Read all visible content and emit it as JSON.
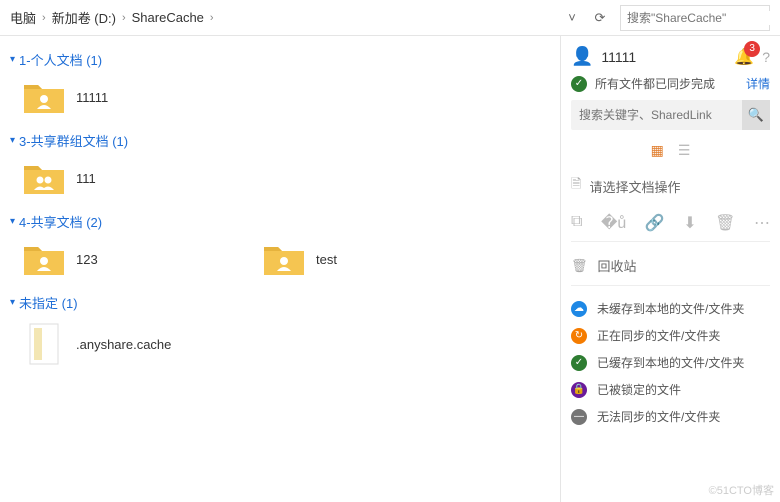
{
  "breadcrumbs": [
    "电脑",
    "新加卷 (D:)",
    "ShareCache"
  ],
  "search": {
    "placeholder": "搜索\"ShareCache\""
  },
  "groups": [
    {
      "label": "1-个人文档 (1)",
      "items": [
        {
          "name": "11111",
          "icon": "person"
        }
      ]
    },
    {
      "label": "3-共享群组文档 (1)",
      "items": [
        {
          "name": "111",
          "icon": "group"
        }
      ]
    },
    {
      "label": "4-共享文档 (2)",
      "items": [
        {
          "name": "123",
          "icon": "person"
        },
        {
          "name": "test",
          "icon": "person"
        }
      ]
    },
    {
      "label": "未指定 (1)",
      "items": [
        {
          "name": ".anyshare.cache",
          "icon": "file"
        }
      ]
    }
  ],
  "panel": {
    "title": "11111",
    "badge": "3",
    "status": "所有文件都已同步完成",
    "detail": "详情",
    "search_placeholder": "搜索关键字、SharedLink",
    "hint": "请选择文档操作",
    "recycle": "回收站",
    "legend": [
      {
        "color": "d-blue",
        "glyph": "☁",
        "text": "未缓存到本地的文件/文件夹"
      },
      {
        "color": "d-orange",
        "glyph": "↻",
        "text": "正在同步的文件/文件夹"
      },
      {
        "color": "d-green",
        "glyph": "✓",
        "text": "已缓存到本地的文件/文件夹"
      },
      {
        "color": "d-purple",
        "glyph": "🔒",
        "text": "已被锁定的文件"
      },
      {
        "color": "d-gray",
        "glyph": "—",
        "text": "无法同步的文件/文件夹"
      }
    ]
  },
  "watermark": "©51CTO博客"
}
